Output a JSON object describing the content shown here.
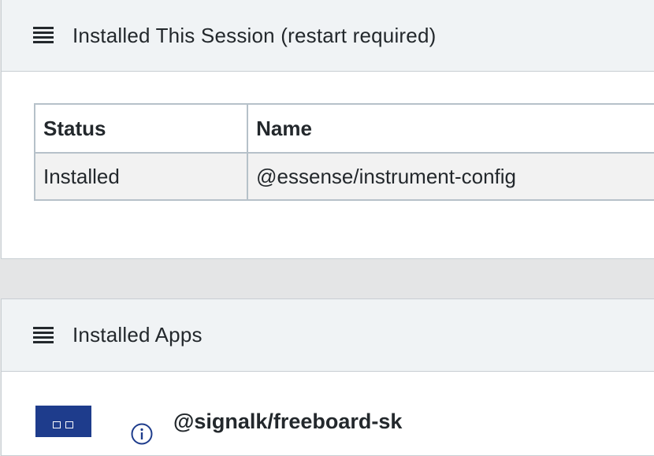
{
  "session_card": {
    "title": "Installed This Session (restart required)",
    "icon": "list-icon",
    "table": {
      "headers": [
        "Status",
        "Name"
      ],
      "rows": [
        {
          "status": "Installed",
          "name": "@essense/instrument-config"
        }
      ]
    }
  },
  "apps_card": {
    "title": "Installed Apps",
    "icon": "list-icon",
    "apps": [
      {
        "name": "@signalk/freeboard-sk",
        "icon": "app-grid-icon",
        "info_icon": "info-icon"
      }
    ]
  },
  "colors": {
    "header_bg": "#f0f3f5",
    "border": "#c8ced3",
    "row_bg": "#f2f2f2",
    "app_icon_bg": "#1e3c8c",
    "page_bg": "#e4e5e6"
  }
}
